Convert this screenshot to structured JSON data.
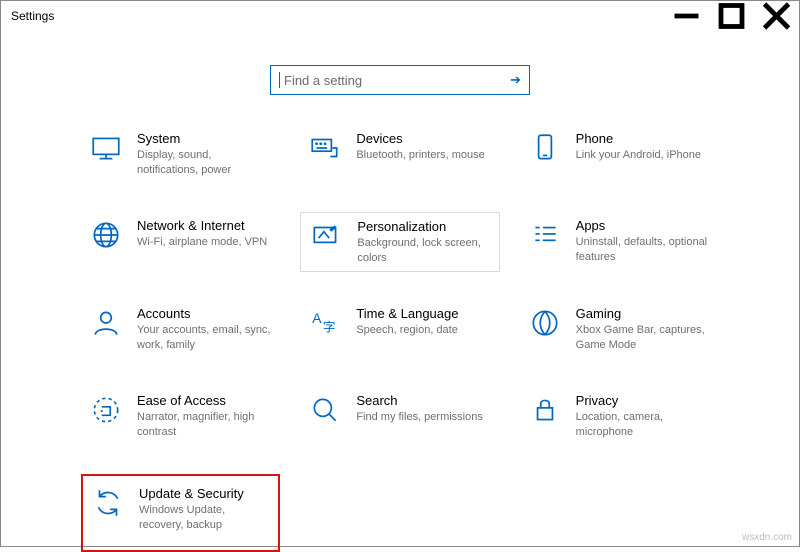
{
  "window": {
    "title": "Settings"
  },
  "search": {
    "placeholder": "Find a setting"
  },
  "tiles": {
    "system": {
      "title": "System",
      "desc": "Display, sound, notifications, power"
    },
    "devices": {
      "title": "Devices",
      "desc": "Bluetooth, printers, mouse"
    },
    "phone": {
      "title": "Phone",
      "desc": "Link your Android, iPhone"
    },
    "network": {
      "title": "Network & Internet",
      "desc": "Wi-Fi, airplane mode, VPN"
    },
    "personal": {
      "title": "Personalization",
      "desc": "Background, lock screen, colors"
    },
    "apps": {
      "title": "Apps",
      "desc": "Uninstall, defaults, optional features"
    },
    "accounts": {
      "title": "Accounts",
      "desc": "Your accounts, email, sync, work, family"
    },
    "time": {
      "title": "Time & Language",
      "desc": "Speech, region, date"
    },
    "gaming": {
      "title": "Gaming",
      "desc": "Xbox Game Bar, captures, Game Mode"
    },
    "ease": {
      "title": "Ease of Access",
      "desc": "Narrator, magnifier, high contrast"
    },
    "searchT": {
      "title": "Search",
      "desc": "Find my files, permissions"
    },
    "privacy": {
      "title": "Privacy",
      "desc": "Location, camera, microphone"
    },
    "update": {
      "title": "Update & Security",
      "desc": "Windows Update, recovery, backup"
    }
  },
  "watermark": "wsxdn.com"
}
